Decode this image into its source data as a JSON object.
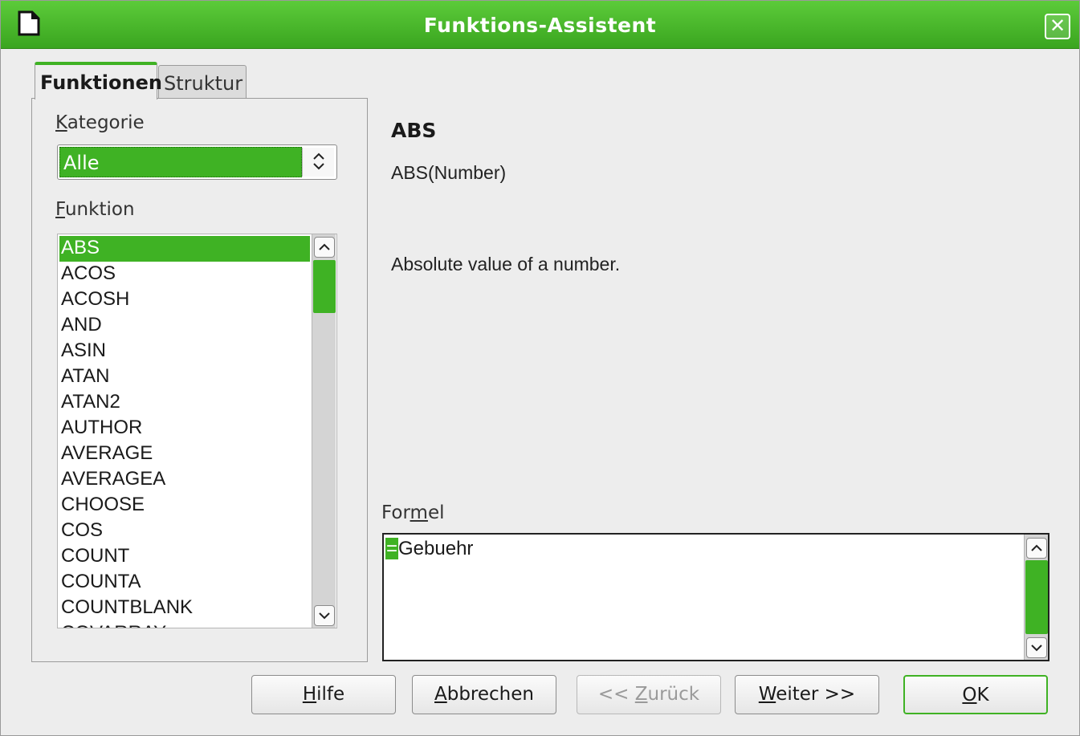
{
  "window": {
    "title": "Funktions-Assistent",
    "close_glyph": "✕"
  },
  "tabs": [
    {
      "label": "Funktionen",
      "active": true
    },
    {
      "label": "Struktur",
      "active": false
    }
  ],
  "left": {
    "kategorie_label_mnemonic": "K",
    "kategorie_label_rest": "ategorie",
    "kategorie_value": "Alle",
    "funktion_label_mnemonic": "F",
    "funktion_label_rest": "unktion",
    "functions": [
      "ABS",
      "ACOS",
      "ACOSH",
      "AND",
      "ASIN",
      "ATAN",
      "ATAN2",
      "AUTHOR",
      "AVERAGE",
      "AVERAGEA",
      "CHOOSE",
      "COS",
      "COUNT",
      "COUNTA",
      "COUNTBLANK",
      "COVARRAY"
    ],
    "selected_index": 0
  },
  "detail": {
    "name": "ABS",
    "syntax": "ABS(Number)",
    "description": "Absolute value of a number."
  },
  "formula": {
    "label_pre": "For",
    "label_mnemonic": "m",
    "label_post": "el",
    "eq": "=",
    "text": "Gebuehr"
  },
  "buttons": {
    "help": {
      "mnemonic": "H",
      "rest": "ilfe"
    },
    "cancel": {
      "mnemonic": "A",
      "rest": "bbrechen"
    },
    "back": {
      "pre": "<< ",
      "mnemonic": "Z",
      "rest": "urück"
    },
    "next": {
      "mnemonic": "W",
      "rest": "eiter >>"
    },
    "ok": {
      "mnemonic": "O",
      "rest": "K"
    }
  },
  "colors": {
    "accent": "#3fb224",
    "titlebar": "#4cbb2c"
  },
  "icons": [
    "document-icon",
    "close-icon",
    "spin-updown-icon",
    "scroll-up-icon",
    "scroll-down-icon"
  ]
}
